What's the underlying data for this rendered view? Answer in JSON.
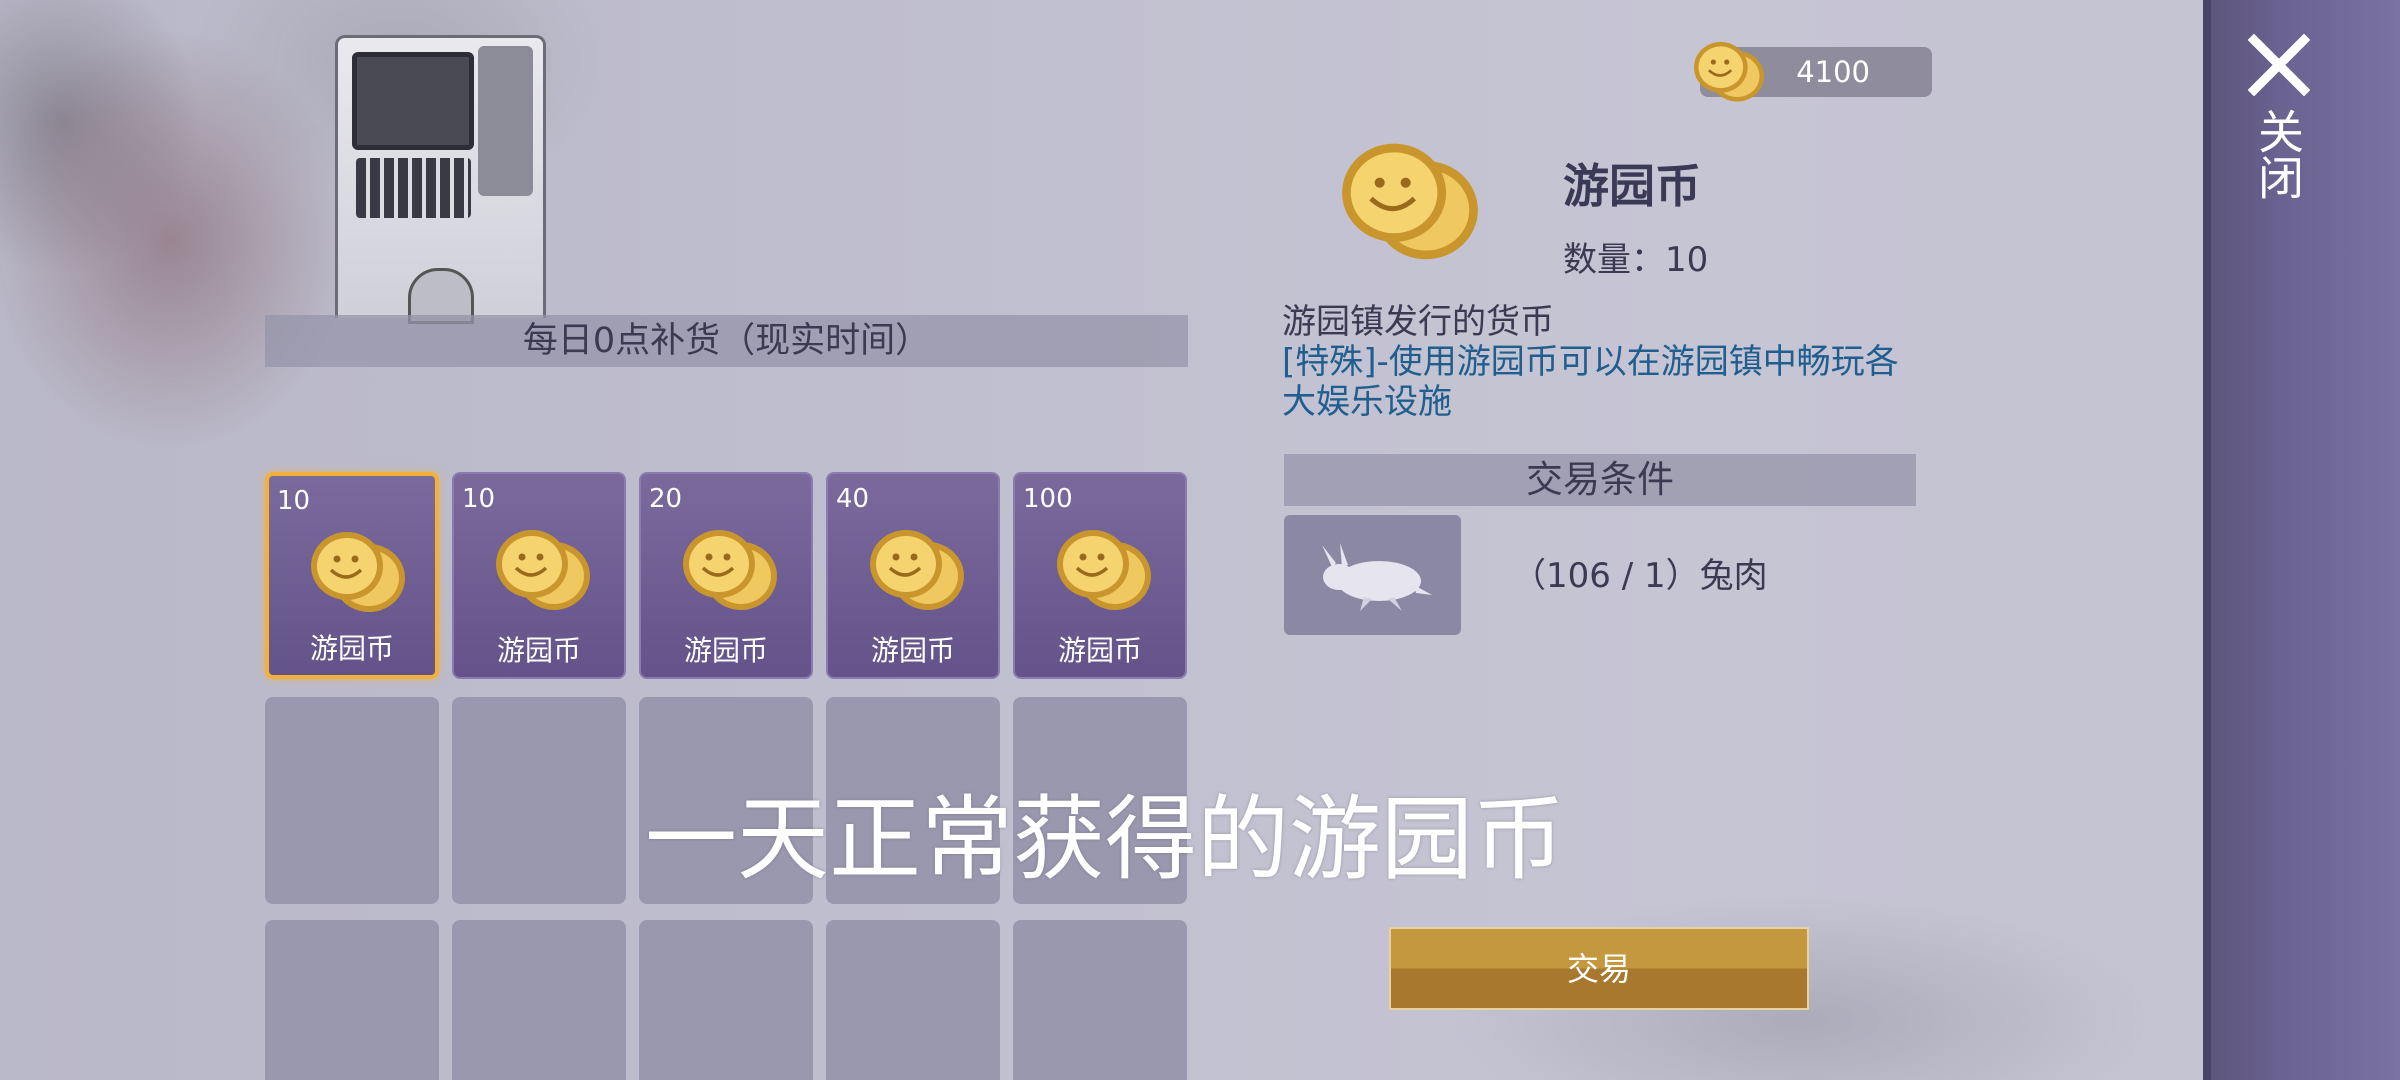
{
  "currency": {
    "icon": "coin-icon",
    "amount": "4100"
  },
  "restock_notice": "每日0点补货（现实时间）",
  "items": [
    {
      "qty": "10",
      "name": "游园币",
      "icon": "coin-icon",
      "selected": true
    },
    {
      "qty": "10",
      "name": "游园币",
      "icon": "coin-icon",
      "selected": false
    },
    {
      "qty": "20",
      "name": "游园币",
      "icon": "coin-icon",
      "selected": false
    },
    {
      "qty": "40",
      "name": "游园币",
      "icon": "coin-icon",
      "selected": false
    },
    {
      "qty": "100",
      "name": "游园币",
      "icon": "coin-icon",
      "selected": false
    }
  ],
  "detail": {
    "title": "游园币",
    "quantity_label": "数量：10",
    "description": "游园镇发行的货币",
    "special": "[特殊]-使用游园币可以在游园镇中畅玩各大娱乐设施"
  },
  "trade_conditions": {
    "header": "交易条件",
    "requirement": {
      "icon": "rabbit-meat-icon",
      "text": "（106 / 1）兔肉"
    }
  },
  "trade_button": "交易",
  "close_label": "关闭",
  "subtitle": "一天正常获得的游园币",
  "colors": {
    "accent_gold": "#c4983f",
    "selected_border": "#f2b23a",
    "card_purple": "#63538a",
    "special_text": "#1f5e8f"
  }
}
